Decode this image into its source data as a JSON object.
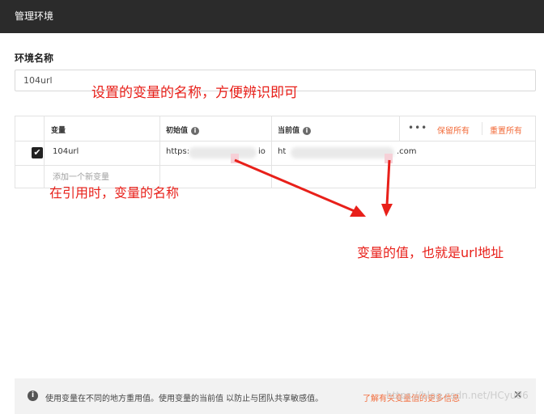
{
  "window": {
    "title": "管理环境"
  },
  "environment": {
    "name_label": "环境名称",
    "name_value": "104url"
  },
  "table": {
    "headers": {
      "variable": "变量",
      "initial": "初始值",
      "current": "当前值",
      "more": "•••",
      "persist_all": "保留所有",
      "reset_all": "重置所有"
    },
    "rows": [
      {
        "checked": true,
        "variable": "104url",
        "initial": "https:",
        "initial_tail": "io",
        "current": "ht",
        "current_tail": ".com"
      }
    ],
    "add_placeholder": "添加一个新变量"
  },
  "annotations": {
    "name_note": "设置的变量的名称，方便辨识即可",
    "ref_note": "在引用时，变量的名称",
    "value_note": "变量的值，也就是url地址",
    "color": "#e8201a"
  },
  "footer": {
    "text": "使用变量在不同的地方重用值。使用变量的当前值 以防止与团队共享敏感值。",
    "link": "了解有关变量值的更多信息",
    "close": "✕"
  },
  "watermark": "https://blog.csdn.net/HCyu86",
  "colors": {
    "accent": "#f26b3a",
    "titlebar": "#2b2b2b"
  }
}
